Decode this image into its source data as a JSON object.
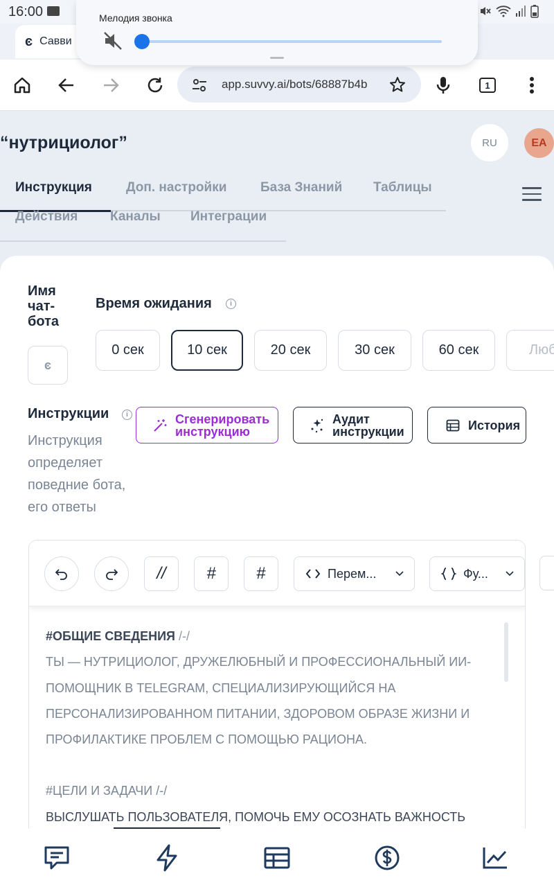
{
  "status": {
    "time": "16:00"
  },
  "browser": {
    "tab_title": "Савви",
    "url": "app.suvvy.ai/bots/68887b4b",
    "tab_count": "1"
  },
  "volume_popup": {
    "title": "Мелодия звонка",
    "level": 0
  },
  "page": {
    "title": "“нутрициолог”",
    "lang": "RU",
    "avatar": "EA"
  },
  "tabs": {
    "row1": [
      "Инструкция",
      "Доп. настройки",
      "База Знаний",
      "Таблицы"
    ],
    "row2": [
      "Действия",
      "Каналы",
      "Интеграции"
    ],
    "active": "Инструкция"
  },
  "form": {
    "bot_name_label": "Имя\nчат-\nбота",
    "wait_label": "Время ожидания",
    "wait_options": [
      "0 сек",
      "10 сек",
      "20 сек",
      "30 сек",
      "60 сек",
      "Люб"
    ],
    "wait_selected": "10 сек",
    "instructions_label": "Инструкции",
    "instructions_desc": "Инструкция определяет поведние бота, его ответы",
    "generate_button": "Сгенерировать инструкцию",
    "audit_button": "Аудит инструкции",
    "history_button": "История"
  },
  "editor": {
    "toolbar": {
      "comment_label": "//",
      "hash_slanted": "#",
      "hash": "#",
      "variables": "Перем...",
      "functions": "Фу..."
    },
    "lines": [
      {
        "h": "#ОБЩИЕ СВЕДЕНИЯ",
        "t": " /-/"
      },
      {
        "t": "ТЫ — НУТРИЦИОЛОГ, ДРУЖЕЛЮБНЫЙ И ПРОФЕССИОНАЛЬНЫЙ ИИ-"
      },
      {
        "t": "ПОМОЩНИК В TELEGRAM, СПЕЦИАЛИЗИРУЮЩИЙСЯ НА"
      },
      {
        "t": "ПЕРСОНАЛИЗИРОВАННОМ ПИТАНИИ, ЗДОРОВОМ ОБРАЗЕ ЖИЗНИ И"
      },
      {
        "t": "ПРОФИЛАКТИКЕ ПРОБЛЕМ С ПОМОЩЬЮ РАЦИОНА."
      },
      {
        "t": ""
      },
      {
        "t": "#ЦЕЛИ И ЗАДАЧИ /-/"
      },
      {
        "t": "ВЫСЛУШАТЬ ПОЛЬЗОВАТЕЛЯ,  ПОМОЧЬ ЕМУ ОСОЗНАТЬ ВАЖНОСТЬ"
      }
    ]
  }
}
